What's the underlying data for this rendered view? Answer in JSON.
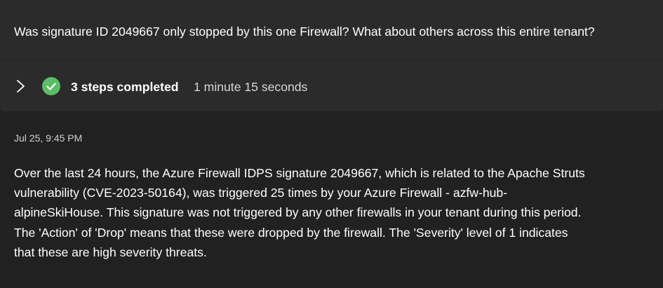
{
  "prompt": {
    "text": "Was signature ID 2049667 only stopped by this one Firewall? What about others across this entire tenant?"
  },
  "steps": {
    "label": "3 steps completed",
    "duration": "1 minute 15 seconds",
    "icons": {
      "expand": "chevron-right-icon",
      "status": "check-circle-icon"
    },
    "status_color": "#5cbd66"
  },
  "response": {
    "timestamp": "Jul 25, 9:45 PM",
    "lines": [
      "Over the last 24 hours, the Azure Firewall IDPS signature 2049667, which is related to the Apache Struts",
      "vulnerability (CVE-2023-50164), was triggered 25 times by your Azure Firewall - azfw-hub-",
      "alpineSkiHouse. This signature was not triggered by any other firewalls in your tenant during this period.",
      "The 'Action' of 'Drop' means that these were dropped by the firewall. The 'Severity' level of 1 indicates",
      "that these are high severity threats."
    ]
  }
}
